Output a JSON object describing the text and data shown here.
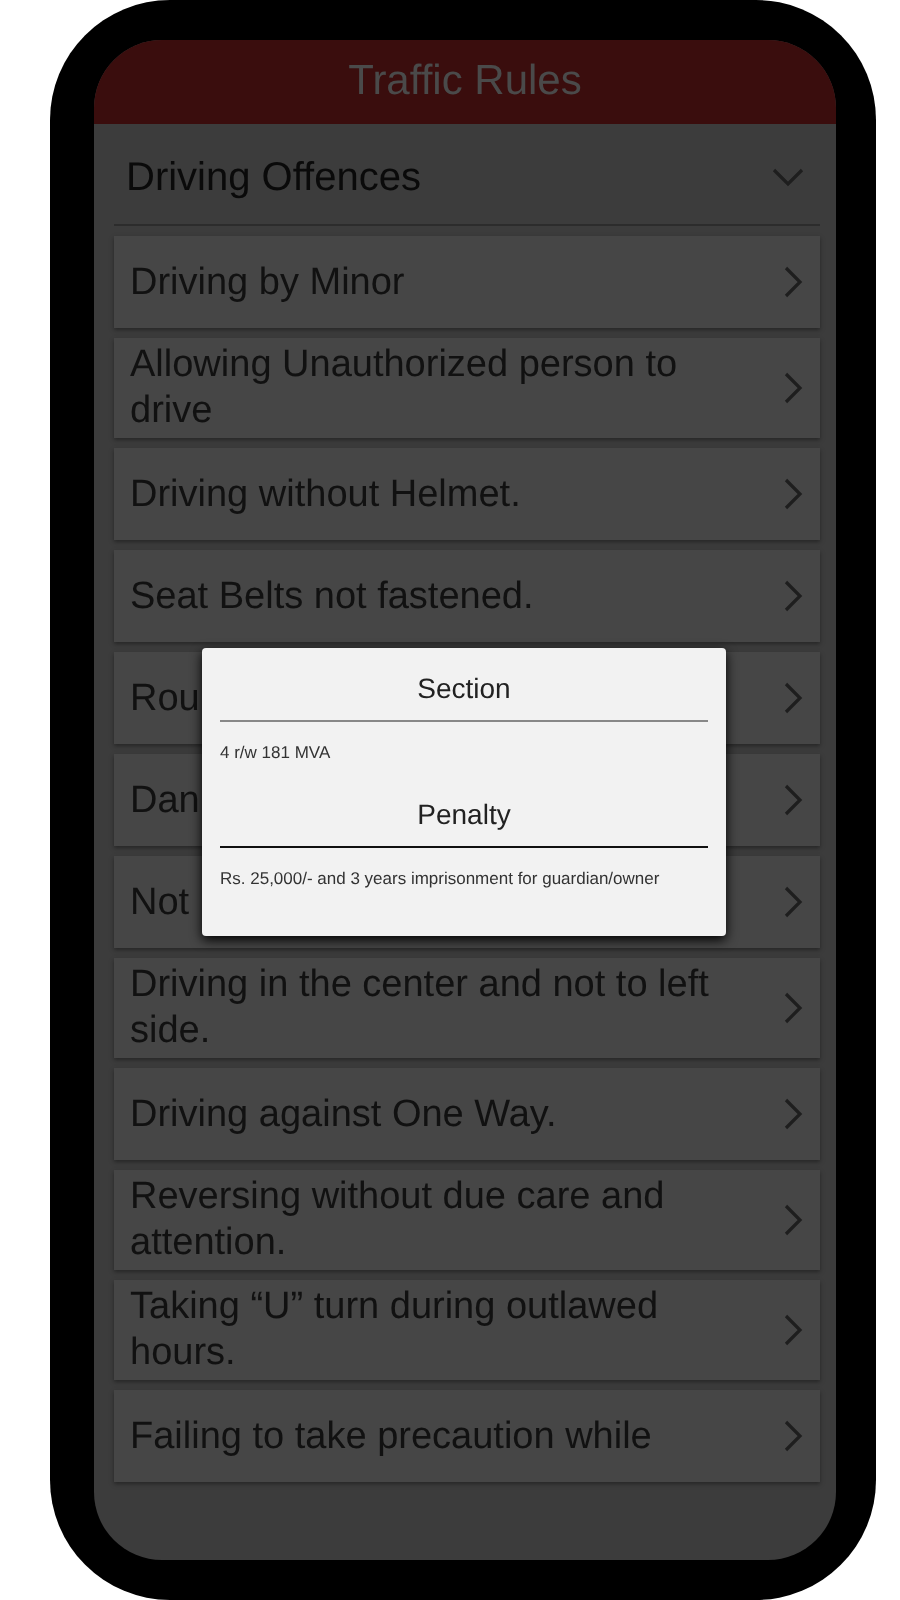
{
  "app_bar": {
    "title": "Traffic Rules"
  },
  "group": {
    "title": "Driving Offences",
    "expanded": true,
    "items": [
      {
        "label": "Driving by Minor"
      },
      {
        "label": "Allowing Unauthorized person to drive"
      },
      {
        "label": "Driving without Helmet."
      },
      {
        "label": "Seat Belts not fastened."
      },
      {
        "label": "Rou"
      },
      {
        "label": "Dan"
      },
      {
        "label": "Not"
      },
      {
        "label": "Driving in the center and not to left side."
      },
      {
        "label": "Driving against One Way."
      },
      {
        "label": "Reversing without due care and attention."
      },
      {
        "label": "Taking “U” turn during outlawed hours."
      },
      {
        "label": "Failing to take precaution while"
      }
    ]
  },
  "dialog": {
    "sections": [
      {
        "heading": "Section",
        "text": "4 r/w 181 MVA"
      },
      {
        "heading": "Penalty",
        "text": "Rs. 25,000/- and 3 years imprisonment for guardian/owner"
      }
    ]
  }
}
